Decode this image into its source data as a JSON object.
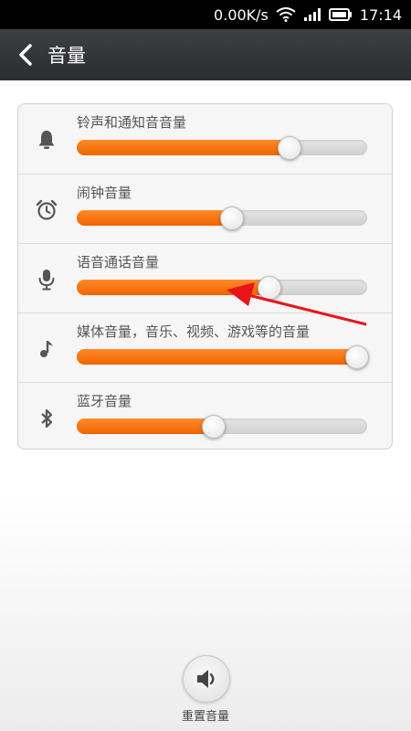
{
  "status": {
    "speed": "0.00K/s",
    "time": "17:14"
  },
  "header": {
    "title": "音量"
  },
  "sliders": [
    {
      "label": "铃声和通知音音量",
      "icon": "bell-icon",
      "value": 0.73
    },
    {
      "label": "闹钟音量",
      "icon": "alarm-clock-icon",
      "value": 0.53
    },
    {
      "label": "语音通话音量",
      "icon": "microphone-icon",
      "value": 0.66
    },
    {
      "label": "媒体音量，音乐、视频、游戏等的音量",
      "icon": "music-note-icon",
      "value": 1.0
    },
    {
      "label": "蓝牙音量",
      "icon": "bluetooth-icon",
      "value": 0.47
    }
  ],
  "reset": {
    "label": "重置音量",
    "icon": "speaker-icon"
  },
  "colors": {
    "accent": "#f06400",
    "header": "#2f3033"
  }
}
